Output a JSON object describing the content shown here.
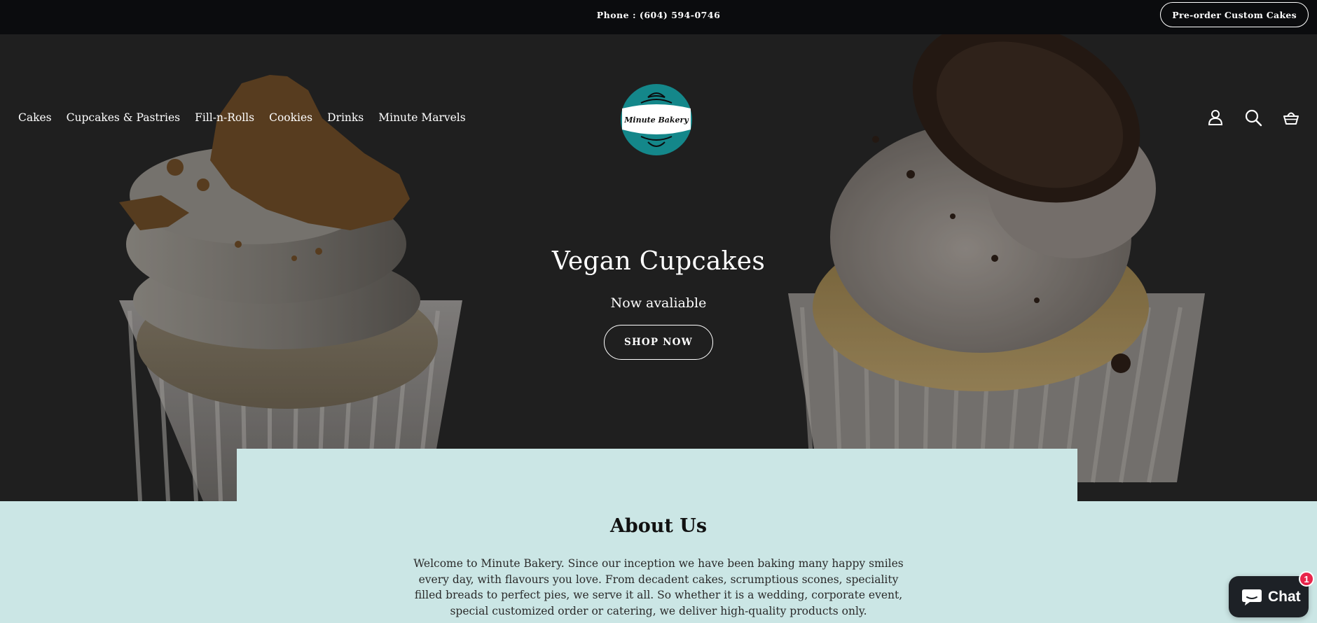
{
  "announcement": {
    "phone_text": "Phone : (604) 594-0746",
    "preorder_label": "Pre-order Custom Cakes"
  },
  "header": {
    "nav": [
      {
        "label": "Cakes"
      },
      {
        "label": "Cupcakes & Pastries"
      },
      {
        "label": "Fill-n-Rolls"
      },
      {
        "label": "Cookies"
      },
      {
        "label": "Drinks"
      },
      {
        "label": "Minute Marvels"
      }
    ],
    "logo_text": "Minute Bakery",
    "icons": [
      "account-icon",
      "search-icon",
      "cart-icon"
    ]
  },
  "hero": {
    "title": "Vegan Cupcakes",
    "subtitle": "Now avaliable",
    "button_label": "SHOP NOW"
  },
  "about": {
    "title": "About Us",
    "text": "Welcome to Minute Bakery. Since our inception we have been baking many happy smiles every day, with flavours you love. From decadent cakes, scrumptious scones, speciality filled breads to perfect pies, we serve it all. So whether it is a wedding, corporate event, special customized order or catering, we deliver high-quality products only."
  },
  "chat": {
    "label": "Chat",
    "badge_count": "1"
  },
  "colors": {
    "topbar": "#0b0c0e",
    "hero_bg": "#272727",
    "about_bg": "#cbe6e5",
    "logo_teal": "#14878a",
    "chat_badge": "#e8254b"
  }
}
